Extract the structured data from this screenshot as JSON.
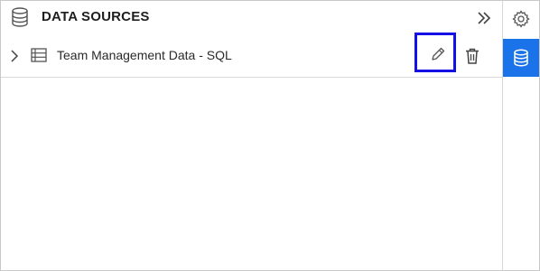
{
  "panel": {
    "title": "DATA SOURCES",
    "header_icon": "database-icon",
    "collapse_icon": "double-chevron-right-icon"
  },
  "datasources": [
    {
      "name": "Team Management Data - SQL",
      "expand_icon": "chevron-right-icon",
      "type_icon": "table-icon",
      "edit_icon": "pencil-icon",
      "delete_icon": "trash-icon"
    }
  ],
  "side_rail": {
    "items": [
      {
        "icon": "gear-icon",
        "active": false
      },
      {
        "icon": "database-icon",
        "active": true
      }
    ]
  },
  "colors": {
    "accent": "#1a73e8",
    "highlight_border": "#1510e6",
    "text": "#1f1f1f"
  }
}
